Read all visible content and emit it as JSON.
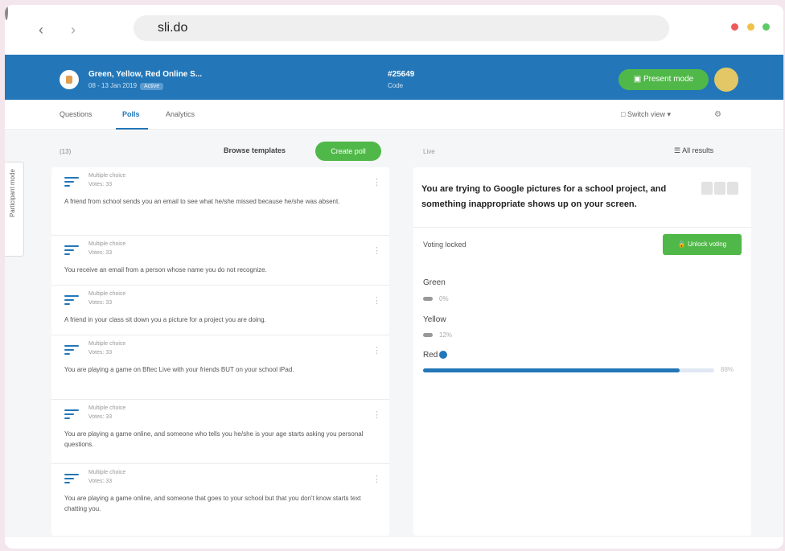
{
  "browser": {
    "url": "sli.do"
  },
  "header": {
    "event_title": "Green, Yellow, Red Online S...",
    "event_date": "08 - 13 Jan 2019",
    "event_badge": "Active",
    "event_code": "#25649",
    "event_code_label": "Code",
    "present_label": "Present mode"
  },
  "tabs": {
    "items": [
      {
        "label": "Questions"
      },
      {
        "label": "Polls"
      },
      {
        "label": "Analytics"
      }
    ],
    "switch_view": "Switch view",
    "active": "Polls"
  },
  "sidebar": {
    "participant_mode": "Participant mode"
  },
  "polls": {
    "count_label": "(13)",
    "browse_label": "Browse templates",
    "create_label": "Create poll",
    "items": [
      {
        "type": "Multiple choice",
        "votes": "Votes: 33",
        "text": "A friend from school sends you an email to see what he/she missed because he/she was absent."
      },
      {
        "type": "Multiple choice",
        "votes": "Votes: 33",
        "text": "You receive an email from a person whose name you do not recognize."
      },
      {
        "type": "Multiple choice",
        "votes": "Votes: 33",
        "text": "A friend in your class sit down you a picture for a project you are doing."
      },
      {
        "type": "Multiple choice",
        "votes": "Votes: 33",
        "text": "You are playing a game on Bftec Live with your friends BUT on your school iPad."
      },
      {
        "type": "Multiple choice",
        "votes": "Votes: 33",
        "text": "You are playing a game online, and someone who tells you he/she is your age starts asking you personal questions."
      },
      {
        "type": "Multiple choice",
        "votes": "Votes: 33",
        "text": "You are playing a game online, and someone that goes to your school but that you don't know starts text chatting you."
      }
    ]
  },
  "results": {
    "live_label": "Live",
    "all_results_label": "All results",
    "question": "You are trying to Google pictures for a school project, and something inappropriate shows up on your screen.",
    "voting_status": "Voting locked",
    "unlock_label": "Unlock voting",
    "options": [
      {
        "label": "Green",
        "percent": "0%",
        "value": 0
      },
      {
        "label": "Yellow",
        "percent": "12%",
        "value": 12
      },
      {
        "label": "Red",
        "percent": "88%",
        "value": 88,
        "correct": true
      }
    ]
  },
  "colors": {
    "brand_blue": "#2377b8",
    "green": "#50b848",
    "avatar": "#e3c766"
  }
}
